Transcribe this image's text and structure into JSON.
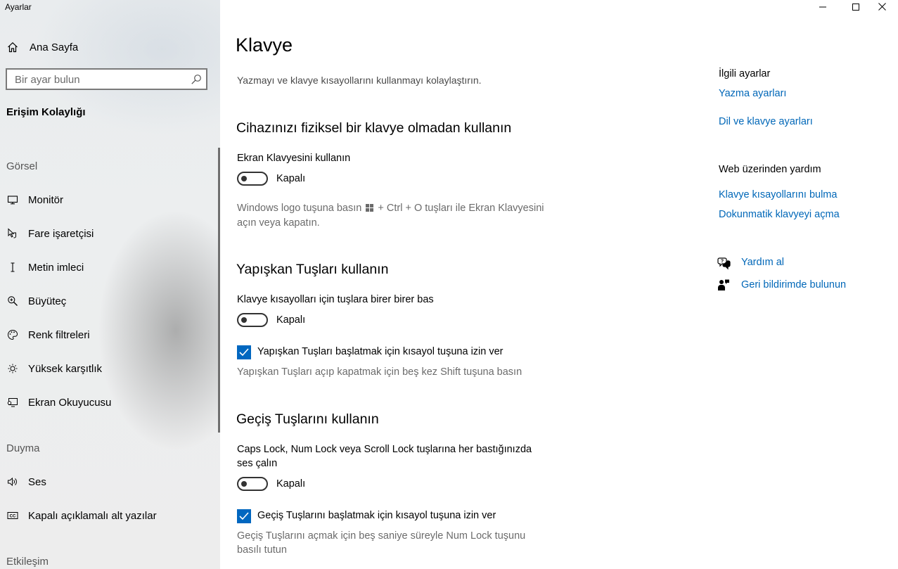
{
  "window": {
    "title": "Ayarlar",
    "controls": [
      "minimize-icon",
      "maximize-icon",
      "close-icon"
    ]
  },
  "sidebar": {
    "home_label": "Ana Sayfa",
    "search_placeholder": "Bir ayar bulun",
    "section_title": "Erişim Kolaylığı",
    "groups": [
      {
        "title": "Görsel",
        "items": [
          {
            "label": "Monitör",
            "icon": "monitor-icon"
          },
          {
            "label": "Fare işaretçisi",
            "icon": "mouse-pointer-icon"
          },
          {
            "label": "Metin imleci",
            "icon": "text-cursor-icon"
          },
          {
            "label": "Büyüteç",
            "icon": "magnifier-icon"
          },
          {
            "label": "Renk filtreleri",
            "icon": "color-filter-icon"
          },
          {
            "label": "Yüksek karşıtlık",
            "icon": "high-contrast-icon"
          },
          {
            "label": "Ekran Okuyucusu",
            "icon": "narrator-icon"
          }
        ]
      },
      {
        "title": "Duyma",
        "items": [
          {
            "label": "Ses",
            "icon": "speaker-icon"
          },
          {
            "label": "Kapalı açıklamalı alt yazılar",
            "icon": "closed-caption-icon"
          }
        ]
      },
      {
        "title": "Etkileşim",
        "items": []
      }
    ]
  },
  "main": {
    "title": "Klavye",
    "subtitle": "Yazmayı ve klavye kısayollarını kullanmayı kolaylaştırın.",
    "sections": [
      {
        "heading": "Cihazınızı fiziksel bir klavye olmadan kullanın",
        "setting_label": "Ekran Klavyesini kullanın",
        "toggle_state": "Kapalı",
        "toggle_on": false,
        "description_part1": "Windows logo tuşuna basın",
        "description_part2": "+ Ctrl + O tuşları ile Ekran Klavyesini",
        "description_line2": "açın veya kapatın."
      },
      {
        "heading": "Yapışkan Tuşları kullanın",
        "setting_label": "Klavye kısayolları için tuşlara birer birer bas",
        "toggle_state": "Kapalı",
        "toggle_on": false,
        "checkbox_label": "Yapışkan Tuşları başlatmak için kısayol tuşuna izin ver",
        "checkbox_checked": true,
        "description": "Yapışkan Tuşları açıp kapatmak için beş kez Shift tuşuna basın"
      },
      {
        "heading": "Geçiş Tuşlarını kullanın",
        "setting_label_line1": "Caps Lock, Num Lock veya Scroll Lock tuşlarına her bastığınızda",
        "setting_label_line2": "ses çalın",
        "toggle_state": "Kapalı",
        "toggle_on": false,
        "checkbox_label": "Geçiş Tuşlarını başlatmak için kısayol tuşuna izin ver",
        "checkbox_checked": true,
        "description_line1": "Geçiş Tuşlarını açmak için beş saniye süreyle Num Lock tuşunu",
        "description_line2": "basılı tutun"
      }
    ]
  },
  "related": {
    "title": "İlgili ayarlar",
    "links": [
      "Yazma ayarları",
      "Dil ve klavye ayarları"
    ],
    "web_help_title": "Web üzerinden yardım",
    "web_links": [
      "Klavye kısayollarını bulma",
      "Dokunmatik klavyeyi açma"
    ],
    "get_help": "Yardım al",
    "feedback": "Geri bildirimde bulunun"
  },
  "colors": {
    "accent": "#0067c0",
    "link": "#0067b8"
  }
}
